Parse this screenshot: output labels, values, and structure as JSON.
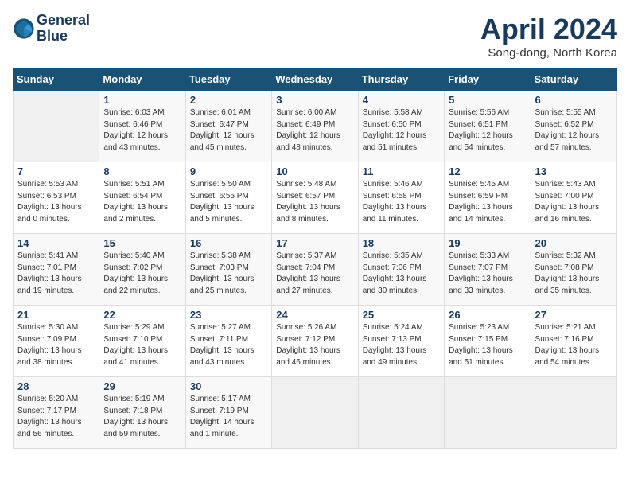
{
  "header": {
    "logo_line1": "General",
    "logo_line2": "Blue",
    "month_title": "April 2024",
    "location": "Song-dong, North Korea"
  },
  "weekdays": [
    "Sunday",
    "Monday",
    "Tuesday",
    "Wednesday",
    "Thursday",
    "Friday",
    "Saturday"
  ],
  "weeks": [
    [
      {
        "day": "",
        "empty": true
      },
      {
        "day": "1",
        "sunrise": "6:03 AM",
        "sunset": "6:46 PM",
        "daylight": "12 hours and 43 minutes."
      },
      {
        "day": "2",
        "sunrise": "6:01 AM",
        "sunset": "6:47 PM",
        "daylight": "12 hours and 45 minutes."
      },
      {
        "day": "3",
        "sunrise": "6:00 AM",
        "sunset": "6:49 PM",
        "daylight": "12 hours and 48 minutes."
      },
      {
        "day": "4",
        "sunrise": "5:58 AM",
        "sunset": "6:50 PM",
        "daylight": "12 hours and 51 minutes."
      },
      {
        "day": "5",
        "sunrise": "5:56 AM",
        "sunset": "6:51 PM",
        "daylight": "12 hours and 54 minutes."
      },
      {
        "day": "6",
        "sunrise": "5:55 AM",
        "sunset": "6:52 PM",
        "daylight": "12 hours and 57 minutes."
      }
    ],
    [
      {
        "day": "7",
        "sunrise": "5:53 AM",
        "sunset": "6:53 PM",
        "daylight": "13 hours and 0 minutes."
      },
      {
        "day": "8",
        "sunrise": "5:51 AM",
        "sunset": "6:54 PM",
        "daylight": "13 hours and 2 minutes."
      },
      {
        "day": "9",
        "sunrise": "5:50 AM",
        "sunset": "6:55 PM",
        "daylight": "13 hours and 5 minutes."
      },
      {
        "day": "10",
        "sunrise": "5:48 AM",
        "sunset": "6:57 PM",
        "daylight": "13 hours and 8 minutes."
      },
      {
        "day": "11",
        "sunrise": "5:46 AM",
        "sunset": "6:58 PM",
        "daylight": "13 hours and 11 minutes."
      },
      {
        "day": "12",
        "sunrise": "5:45 AM",
        "sunset": "6:59 PM",
        "daylight": "13 hours and 14 minutes."
      },
      {
        "day": "13",
        "sunrise": "5:43 AM",
        "sunset": "7:00 PM",
        "daylight": "13 hours and 16 minutes."
      }
    ],
    [
      {
        "day": "14",
        "sunrise": "5:41 AM",
        "sunset": "7:01 PM",
        "daylight": "13 hours and 19 minutes."
      },
      {
        "day": "15",
        "sunrise": "5:40 AM",
        "sunset": "7:02 PM",
        "daylight": "13 hours and 22 minutes."
      },
      {
        "day": "16",
        "sunrise": "5:38 AM",
        "sunset": "7:03 PM",
        "daylight": "13 hours and 25 minutes."
      },
      {
        "day": "17",
        "sunrise": "5:37 AM",
        "sunset": "7:04 PM",
        "daylight": "13 hours and 27 minutes."
      },
      {
        "day": "18",
        "sunrise": "5:35 AM",
        "sunset": "7:06 PM",
        "daylight": "13 hours and 30 minutes."
      },
      {
        "day": "19",
        "sunrise": "5:33 AM",
        "sunset": "7:07 PM",
        "daylight": "13 hours and 33 minutes."
      },
      {
        "day": "20",
        "sunrise": "5:32 AM",
        "sunset": "7:08 PM",
        "daylight": "13 hours and 35 minutes."
      }
    ],
    [
      {
        "day": "21",
        "sunrise": "5:30 AM",
        "sunset": "7:09 PM",
        "daylight": "13 hours and 38 minutes."
      },
      {
        "day": "22",
        "sunrise": "5:29 AM",
        "sunset": "7:10 PM",
        "daylight": "13 hours and 41 minutes."
      },
      {
        "day": "23",
        "sunrise": "5:27 AM",
        "sunset": "7:11 PM",
        "daylight": "13 hours and 43 minutes."
      },
      {
        "day": "24",
        "sunrise": "5:26 AM",
        "sunset": "7:12 PM",
        "daylight": "13 hours and 46 minutes."
      },
      {
        "day": "25",
        "sunrise": "5:24 AM",
        "sunset": "7:13 PM",
        "daylight": "13 hours and 49 minutes."
      },
      {
        "day": "26",
        "sunrise": "5:23 AM",
        "sunset": "7:15 PM",
        "daylight": "13 hours and 51 minutes."
      },
      {
        "day": "27",
        "sunrise": "5:21 AM",
        "sunset": "7:16 PM",
        "daylight": "13 hours and 54 minutes."
      }
    ],
    [
      {
        "day": "28",
        "sunrise": "5:20 AM",
        "sunset": "7:17 PM",
        "daylight": "13 hours and 56 minutes."
      },
      {
        "day": "29",
        "sunrise": "5:19 AM",
        "sunset": "7:18 PM",
        "daylight": "13 hours and 59 minutes."
      },
      {
        "day": "30",
        "sunrise": "5:17 AM",
        "sunset": "7:19 PM",
        "daylight": "14 hours and 1 minute."
      },
      {
        "day": "",
        "empty": true
      },
      {
        "day": "",
        "empty": true
      },
      {
        "day": "",
        "empty": true
      },
      {
        "day": "",
        "empty": true
      }
    ]
  ],
  "labels": {
    "sunrise_prefix": "Sunrise: ",
    "sunset_prefix": "Sunset: ",
    "daylight_prefix": "Daylight: "
  }
}
